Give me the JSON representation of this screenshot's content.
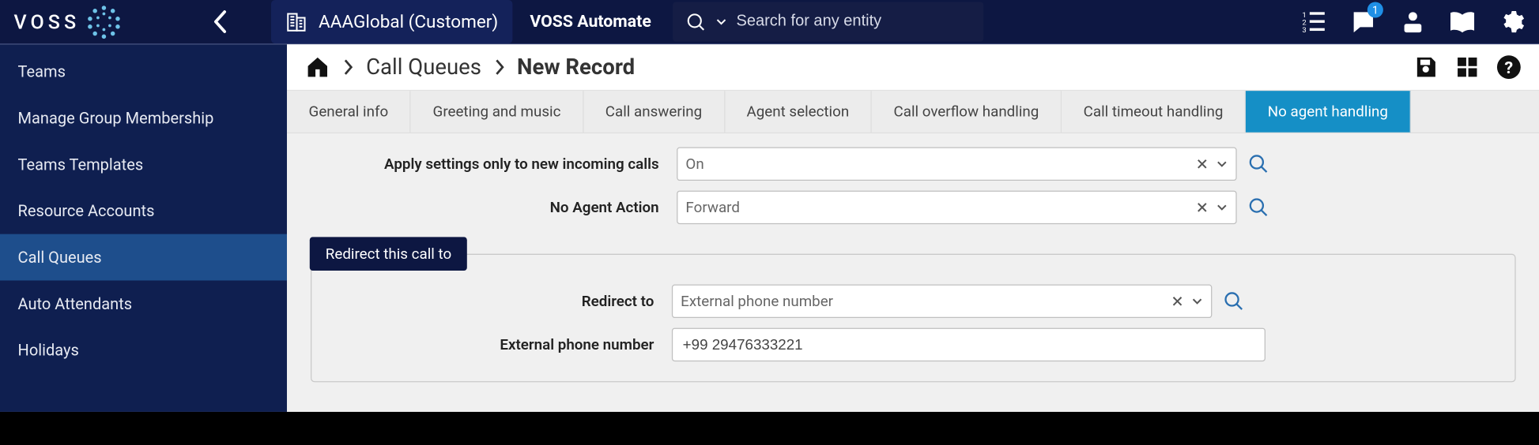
{
  "topbar": {
    "logo_text": "VOSS",
    "context_label": "AAAGlobal (Customer)",
    "product_name": "VOSS Automate",
    "search_placeholder": "Search for any entity",
    "chat_badge": "1"
  },
  "sidebar": {
    "items": [
      {
        "label": "Teams",
        "active": false
      },
      {
        "label": "Manage Group Membership",
        "active": false
      },
      {
        "label": "Teams Templates",
        "active": false
      },
      {
        "label": "Resource Accounts",
        "active": false
      },
      {
        "label": "Call Queues",
        "active": true
      },
      {
        "label": "Auto Attendants",
        "active": false
      },
      {
        "label": "Holidays",
        "active": false
      }
    ]
  },
  "breadcrumb": {
    "parent": "Call Queues",
    "current": "New Record"
  },
  "tabs": [
    {
      "label": "General info",
      "active": false
    },
    {
      "label": "Greeting and music",
      "active": false
    },
    {
      "label": "Call answering",
      "active": false
    },
    {
      "label": "Agent selection",
      "active": false
    },
    {
      "label": "Call overflow handling",
      "active": false
    },
    {
      "label": "Call timeout handling",
      "active": false
    },
    {
      "label": "No agent handling",
      "active": true
    }
  ],
  "form": {
    "apply_label": "Apply settings only to new incoming calls",
    "apply_value": "On",
    "no_agent_label": "No Agent Action",
    "no_agent_value": "Forward",
    "fieldset_legend": "Redirect this call to",
    "redirect_label": "Redirect to",
    "redirect_value": "External phone number",
    "ext_label": "External phone number",
    "ext_value": "+99 29476333221"
  }
}
